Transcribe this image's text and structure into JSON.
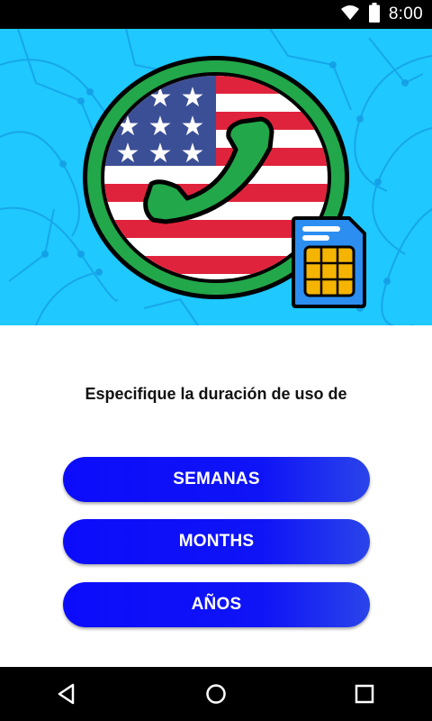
{
  "status_bar": {
    "time": "8:00",
    "icons": [
      "wifi-icon",
      "battery-icon"
    ]
  },
  "hero": {
    "background_color": "#1fc8ff",
    "illustration": [
      "us-flag-phone-icon",
      "sim-card-icon"
    ]
  },
  "prompt": {
    "text": "Especifique la duración de uso de"
  },
  "options": [
    {
      "label": "SEMANAS"
    },
    {
      "label": "MONTHS"
    },
    {
      "label": "AÑOS"
    }
  ],
  "colors": {
    "button": "#0c0cfb",
    "button_text": "#ffffff",
    "status_bar": "#000000",
    "nav_bar": "#000000"
  },
  "nav_bar": {
    "icons": [
      "back-icon",
      "home-icon",
      "recents-icon"
    ]
  }
}
